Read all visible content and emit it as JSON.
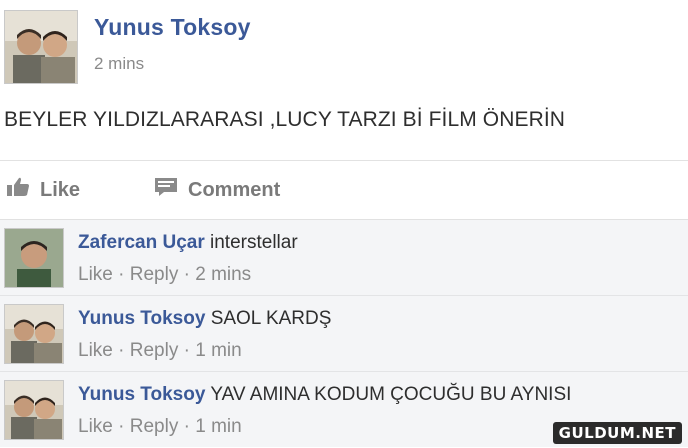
{
  "post": {
    "author": "Yunus Toksoy",
    "time": "2 mins",
    "text": "BEYLER YILDIZLARARASI ,LUCY TARZI Bİ FİLM ÖNERİN"
  },
  "actions": {
    "like_label": "Like",
    "comment_label": "Comment"
  },
  "comments": [
    {
      "author": "Zafercan Uçar",
      "text": "interstellar",
      "like": "Like",
      "reply": "Reply",
      "time": "2 mins"
    },
    {
      "author": "Yunus Toksoy",
      "text": "SAOL KARDŞ",
      "like": "Like",
      "reply": "Reply",
      "time": "1 min"
    },
    {
      "author": "Yunus Toksoy",
      "text": "YAV AMINA KODUM ÇOCUĞU BU AYNISI",
      "like": "Like",
      "reply": "Reply",
      "time": "1 min"
    }
  ],
  "watermark": "GULDUM.NET",
  "colors": {
    "author_link": "#3b5998",
    "meta": "#8a8a8a",
    "comment_bg": "#f4f5f7"
  },
  "icons": {
    "like": "thumbs-up-icon",
    "comment": "comment-icon"
  }
}
